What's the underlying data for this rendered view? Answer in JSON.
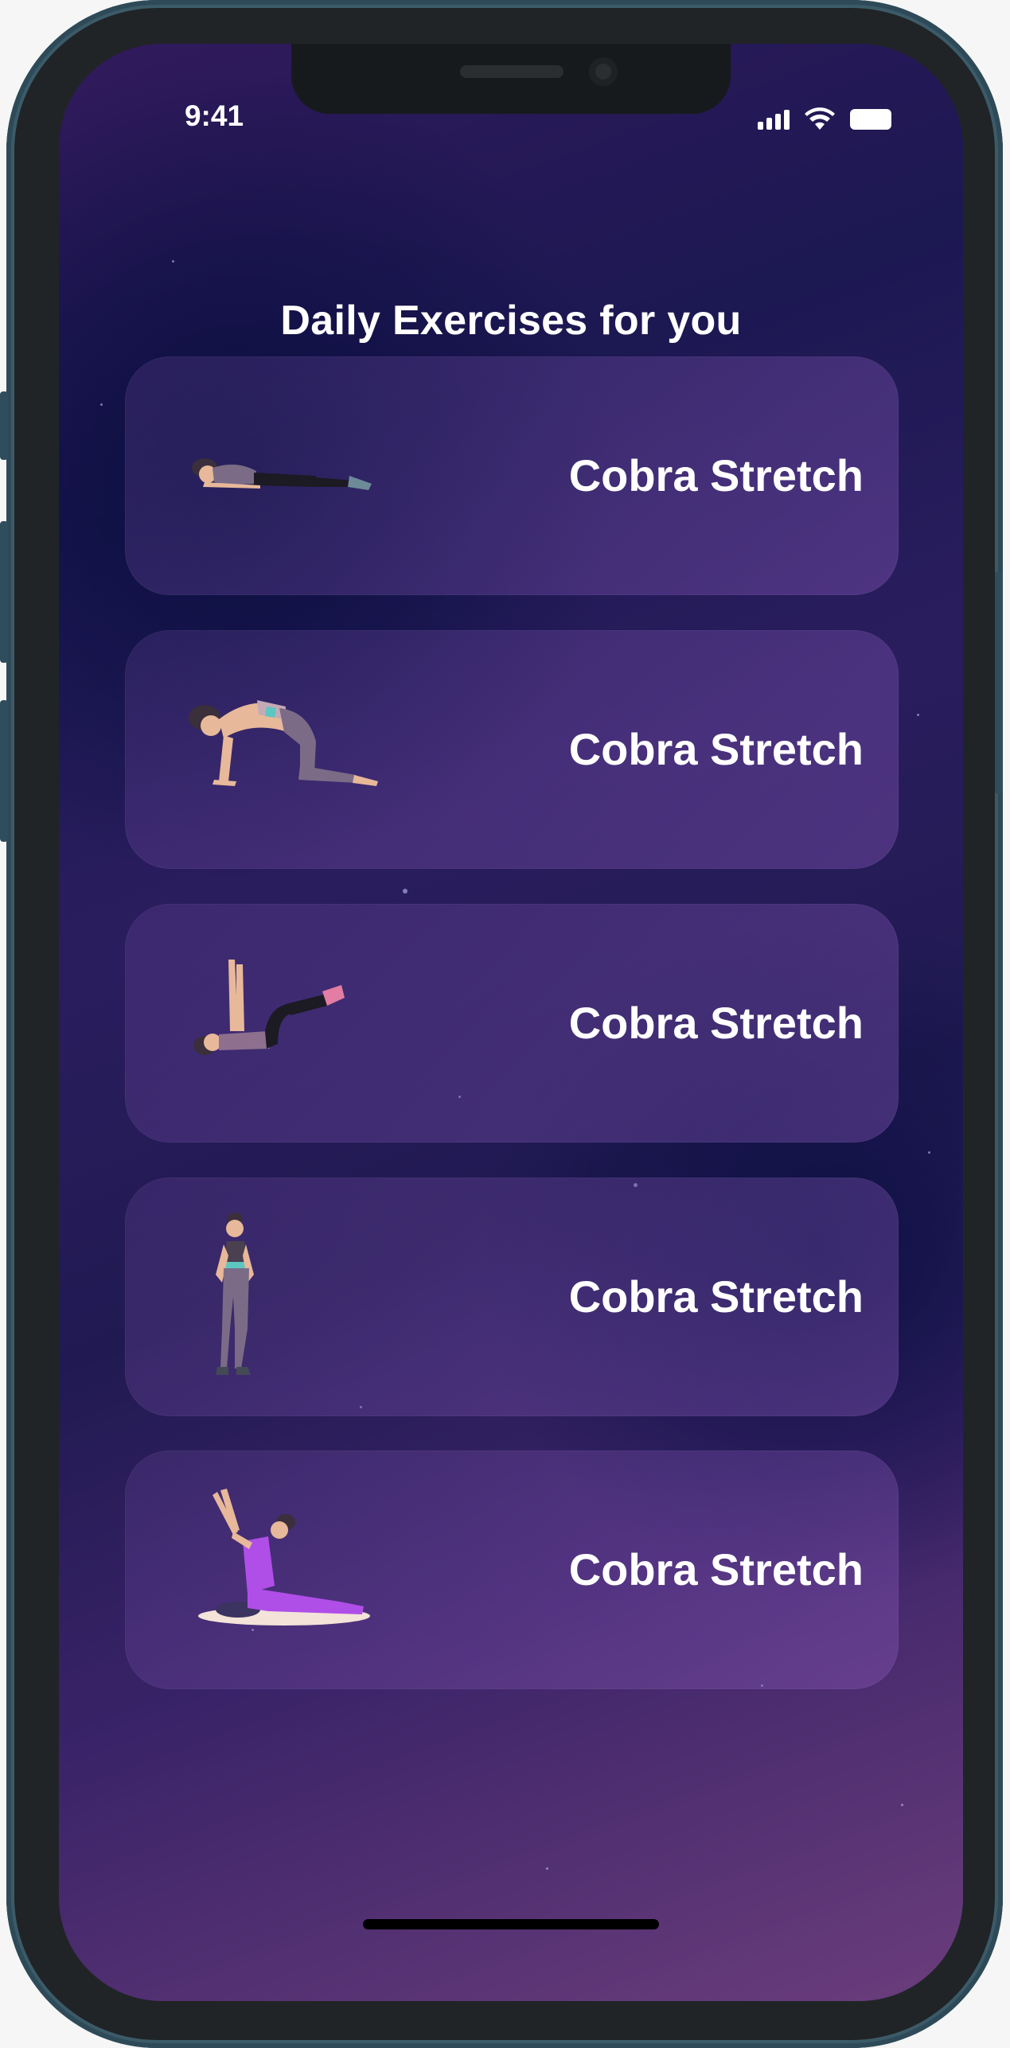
{
  "status_bar": {
    "time": "9:41"
  },
  "header": {
    "title": "Daily Exercises for you"
  },
  "exercises": [
    {
      "label": "Cobra Stretch",
      "pose": "prone-lying-figure-icon"
    },
    {
      "label": "Cobra Stretch",
      "pose": "cat-cow-pose-figure-icon"
    },
    {
      "label": "Cobra Stretch",
      "pose": "leg-raise-figure-icon"
    },
    {
      "label": "Cobra Stretch",
      "pose": "standing-figure-icon"
    },
    {
      "label": "Cobra Stretch",
      "pose": "seated-stretch-figure-icon"
    }
  ],
  "colors": {
    "accent": "#7c4fb5",
    "text": "#ffffff",
    "background": "#1c1852"
  }
}
